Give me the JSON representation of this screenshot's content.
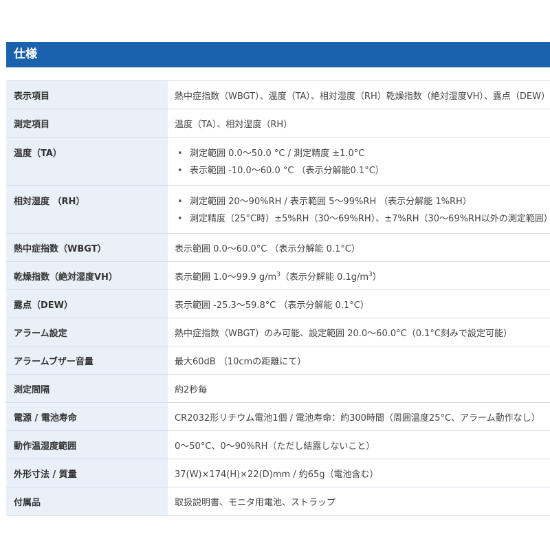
{
  "section": {
    "title": "仕様"
  },
  "rows": [
    {
      "label": "表示項目",
      "value": "熱中症指数（WBGT）、温度（TA）、相対湿度（RH）乾燥指数（絶対湿度VH）、露点（DEW）"
    },
    {
      "label": "測定項目",
      "value": "温度（TA）、相対湿度（RH）"
    },
    {
      "label": "温度（TA）",
      "bullets": [
        "測定範囲 0.0〜50.0 °C / 測定精度 ±1.0°C",
        "表示範囲 -10.0〜60.0 °C （表示分解能0.1°C）"
      ]
    },
    {
      "label": "相対湿度 （RH）",
      "bullets": [
        "測定範囲 20〜90%RH / 表示範囲 5〜99%RH （表示分解能 1%RH）",
        "測定精度（25°C時）±5%RH（30〜69%RH）、±7%RH（30〜69%RH以外の測定範囲）"
      ]
    },
    {
      "label": "熱中症指数（WBGT）",
      "value": "表示範囲 0.0〜60.0°C （表示分解能 0.1°C）"
    },
    {
      "label": "乾燥指数（絶対湿度VH）",
      "value_a": "表示範囲 1.0〜99.9 g/m",
      "sup_a": "3",
      "value_b": "（表示分解能 0.1g/m",
      "sup_b": "3",
      "value_c": "）"
    },
    {
      "label": "露点（DEW）",
      "value": "表示範囲 -25.3〜59.8°C （表示分解能 0.1°C）"
    },
    {
      "label": "アラーム設定",
      "value": "熱中症指数（WBGT）のみ可能、設定範囲 20.0〜60.0°C（0.1°C刻みで設定可能）"
    },
    {
      "label": "アラームブザー音量",
      "value": "最大60dB （10cmの距離にて）"
    },
    {
      "label": "測定間隔",
      "value": "約2秒毎"
    },
    {
      "label": "電源 / 電池寿命",
      "value": "CR2032形リチウム電池1個 / 電池寿命：約300時間（周囲温度25°C、アラーム動作なし）"
    },
    {
      "label": "動作温湿度範囲",
      "value": "0〜50°C、0〜90%RH（ただし結露しないこと）"
    },
    {
      "label": "外形寸法 / 質量",
      "value": "37(W)×174(H)×22(D)mm / 約65g（電池含む）"
    },
    {
      "label": "付属品",
      "value": "取扱説明書、モニタ用電池、ストラップ"
    }
  ]
}
